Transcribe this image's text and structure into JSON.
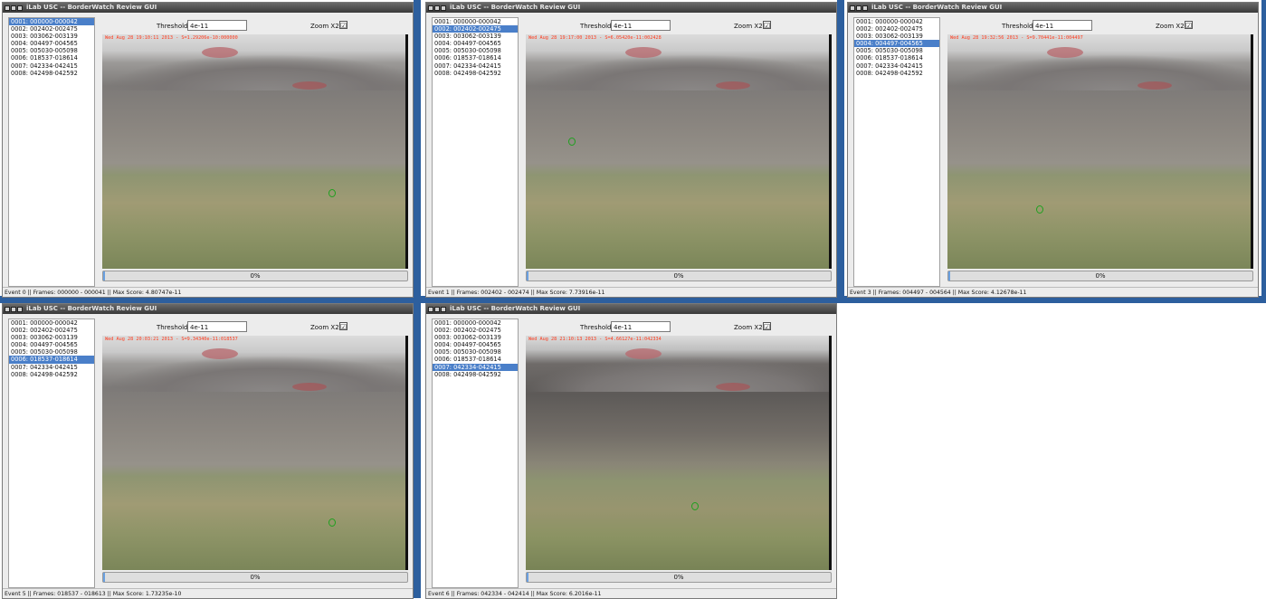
{
  "app_title": "iLab USC -- BorderWatch Review GUI",
  "threshold_label": "Threshold:",
  "threshold_value": "4e-11",
  "zoom_label": "Zoom X2:",
  "zoom_checked": "☑",
  "events": [
    "0001: 000000-000042",
    "0002: 002402-002475",
    "0003: 003062-003139",
    "0004: 004497-004565",
    "0005: 005030-005098",
    "0006: 018537-018614",
    "0007: 042334-042415",
    "0008: 042498-042592"
  ],
  "colors": {
    "accent": "#4a7fc9",
    "timestamp": "#ff3b1e",
    "marker": "#1fa01f",
    "desktop": "#2d5f9e"
  },
  "windows": [
    {
      "selected": 0,
      "timestamp": "Wed Aug 28 19:10:11 2013 - S=1.29206e-10:000000",
      "progress_text": "0%",
      "progress_fraction": 0.005,
      "status": "Event 0 || Frames: 000000 - 000041 || Max Score: 4.80747e-11",
      "marker_pos": [
        0.74,
        0.66
      ]
    },
    {
      "selected": 1,
      "timestamp": "Wed Aug 28 19:17:00 2013 - S=6.05420e-11:002428",
      "progress_text": "0%",
      "progress_fraction": 0.005,
      "status": "Event 1 || Frames: 002402 - 002474 || Max Score: 7.73916e-11",
      "marker_pos": [
        0.14,
        0.44
      ]
    },
    {
      "selected": 3,
      "timestamp": "Wed Aug 28 19:32:56 2013 - S=9.70441e-11:004497",
      "progress_text": "0%",
      "progress_fraction": 0.005,
      "status": "Event 3 || Frames: 004497 - 004564 || Max Score: 4.12678e-11",
      "marker_pos": [
        0.29,
        0.73
      ]
    },
    {
      "selected": 5,
      "timestamp": "Wed Aug 28 20:03:21 2013 - S=9.34340e-11:018537",
      "progress_text": "0%",
      "progress_fraction": 0.005,
      "status": "Event 5 || Frames: 018537 - 018613 || Max Score: 1.73235e-10",
      "marker_pos": [
        0.74,
        0.78
      ]
    },
    {
      "selected": 6,
      "timestamp": "Wed Aug 28 21:10:13 2013 - S=4.66127e-11:042334",
      "progress_text": "0%",
      "progress_fraction": 0.005,
      "status": "Event 6 || Frames: 042334 - 042414 || Max Score: 6.2016e-11",
      "marker_pos": [
        0.54,
        0.71
      ]
    }
  ]
}
